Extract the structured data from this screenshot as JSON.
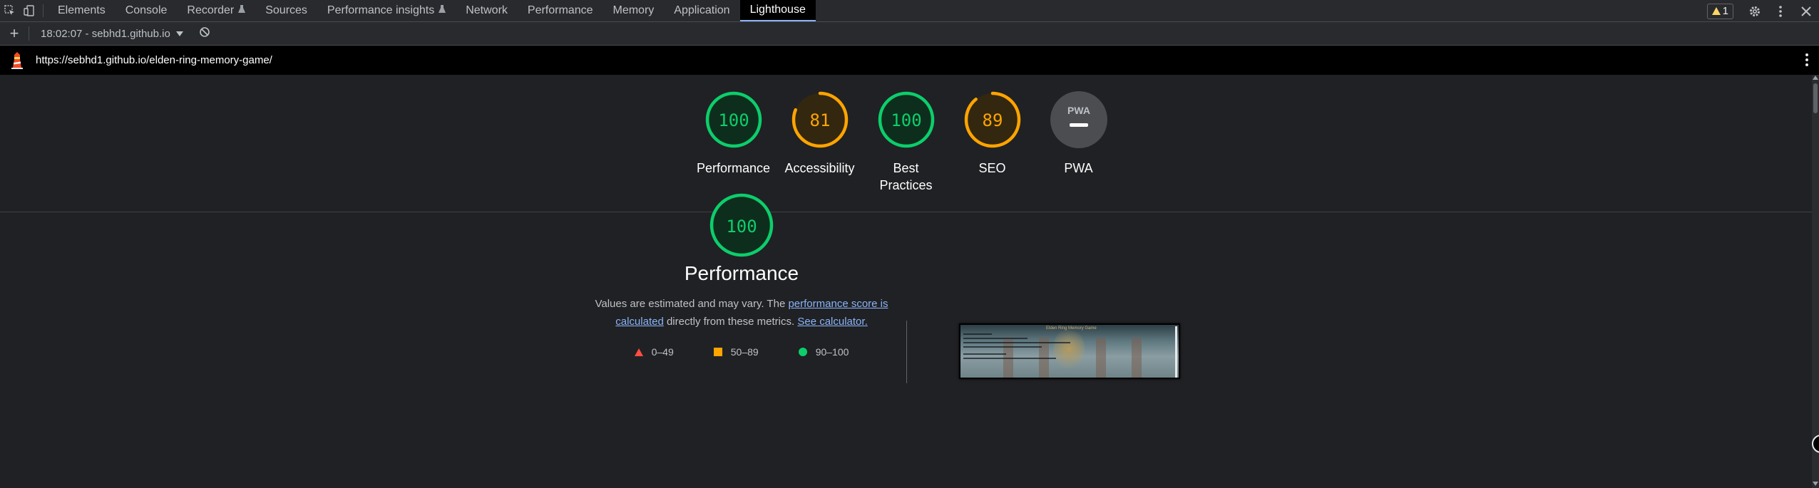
{
  "devtools": {
    "tabs": [
      {
        "label": "Elements"
      },
      {
        "label": "Console"
      },
      {
        "label": "Recorder"
      },
      {
        "label": "Sources"
      },
      {
        "label": "Performance insights"
      },
      {
        "label": "Network"
      },
      {
        "label": "Performance"
      },
      {
        "label": "Memory"
      },
      {
        "label": "Application"
      },
      {
        "label": "Lighthouse"
      }
    ],
    "active_tab": "Lighthouse",
    "warning_count": "1"
  },
  "report_toolbar": {
    "new_report": "+",
    "report_label": "18:02:07 - sebhd1.github.io"
  },
  "url": "https://sebhd1.github.io/elden-ring-memory-game/",
  "categories": [
    {
      "label": "Performance",
      "score": "100",
      "fraction": 1.0,
      "status": "pass"
    },
    {
      "label": "Accessibility",
      "score": "81",
      "fraction": 0.81,
      "status": "average"
    },
    {
      "label": "Best",
      "label2": "Practices",
      "score": "100",
      "fraction": 1.0,
      "status": "pass"
    },
    {
      "label": "SEO",
      "score": "89",
      "fraction": 0.89,
      "status": "average"
    },
    {
      "label": "PWA",
      "badge": "PWA",
      "status": "na"
    }
  ],
  "performance": {
    "score": "100",
    "fraction": 1.0,
    "title": "Performance",
    "desc_before": "Values are estimated and may vary. The ",
    "desc_link1": "performance score is calculated",
    "desc_middle": " directly from these metrics. ",
    "desc_link2": "See calculator.",
    "legend": {
      "fail": "0–49",
      "average": "50–89",
      "pass": "90–100"
    },
    "screenshot_title": "Elden Ring Memory Game"
  },
  "colors": {
    "pass": "#0cce6b",
    "pass_bg": "#0e2e1d",
    "average": "#ffa400",
    "average_bg": "#33270f",
    "fail": "#ff4e42",
    "na_bg": "#4b4d50",
    "link": "#8ab4f8"
  }
}
